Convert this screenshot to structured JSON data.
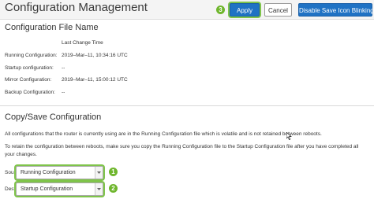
{
  "header": {
    "title": "Configuration Management",
    "apply_label": "Apply",
    "cancel_label": "Cancel",
    "blink_label": "Disable Save Icon Blinking",
    "apply_step": "3"
  },
  "file_section": {
    "title": "Configuration File Name",
    "column_header": "Last Change Time",
    "rows": [
      {
        "name": "Running Configuration:",
        "time": "2019–Mar–11, 10:34:16 UTC"
      },
      {
        "name": "Startup configuration:",
        "time": "--"
      },
      {
        "name": "Mirror Configuration:",
        "time": "2019–Mar–11, 15:00:12 UTC"
      },
      {
        "name": "Backup Configuration:",
        "time": "--"
      }
    ]
  },
  "copy_section": {
    "title": "Copy/Save Configuration",
    "para1": "All configurations that the router is currently using are in the Running Configuration file which is volatile and is not retained between reboots.",
    "para2": "To retain the configuration between reboots, make sure you copy the Running Configuration file to the Startup Configuration file after you have completed all your changes.",
    "source": {
      "label": "Source:",
      "value": "Running Configuration",
      "step": "1"
    },
    "destination": {
      "label": "Destination:",
      "value": "Startup Configuration",
      "step": "2"
    }
  },
  "colors": {
    "accent": "#1f72c4",
    "highlight": "#6fb62d"
  }
}
